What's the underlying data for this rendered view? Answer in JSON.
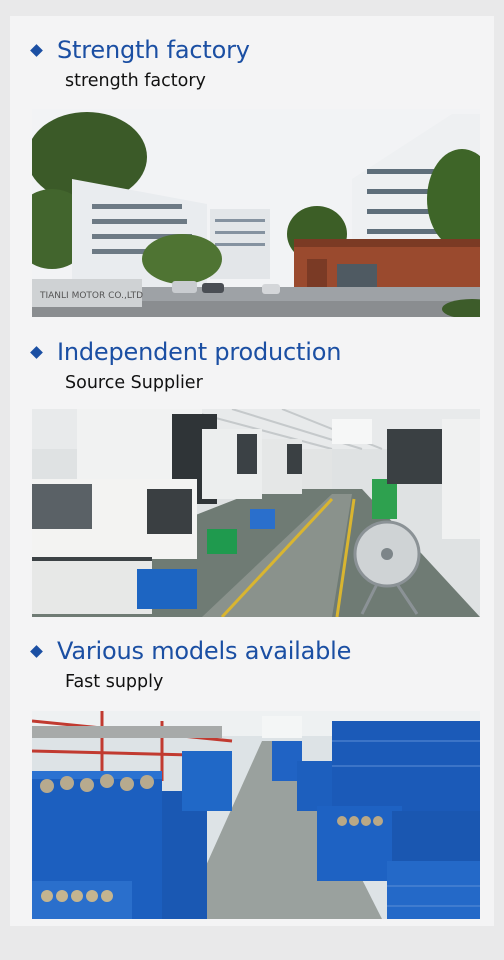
{
  "sections": [
    {
      "title": "Strength factory",
      "subtitle": "strength factory",
      "image_icon": "factory-building-photo",
      "sign_text": "TIANLI MOTOR CO.,LTD"
    },
    {
      "title": "Independent production",
      "subtitle": "Source Supplier",
      "image_icon": "production-line-photo"
    },
    {
      "title": "Various models available",
      "subtitle": "Fast supply",
      "image_icon": "warehouse-stock-photo"
    }
  ],
  "colors": {
    "accent": "#1b4fa3",
    "background": "#e9e9ea",
    "card": "#f4f4f5"
  }
}
